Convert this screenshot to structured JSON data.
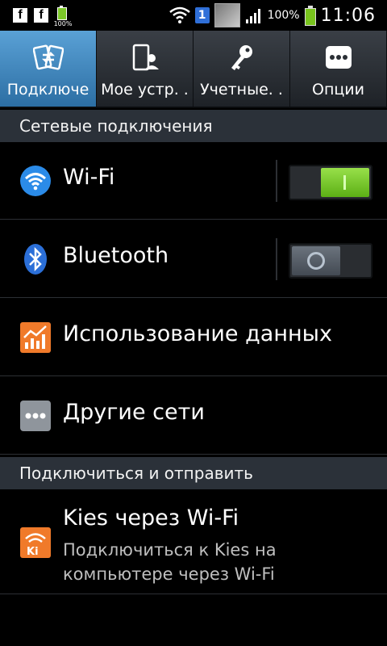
{
  "status_bar": {
    "small_battery_pct": "100%",
    "sim_badge": "1",
    "battery_pct": "100%",
    "time": "11:06",
    "icons": [
      "facebook-icon",
      "facebook-icon",
      "battery-icon",
      "wifi-icon",
      "sim-icon",
      "image-thumbnail",
      "signal-icon",
      "battery-icon"
    ]
  },
  "tabs": [
    {
      "label": "Подключе",
      "icon": "connections-icon",
      "active": true
    },
    {
      "label": "Мое устр. .",
      "icon": "device-icon",
      "active": false
    },
    {
      "label": "Учетные. .",
      "icon": "key-icon",
      "active": false
    },
    {
      "label": "Опции",
      "icon": "more-icon",
      "active": false
    }
  ],
  "sections": {
    "network": "Сетевые подключения",
    "share": "Подключиться и отправить"
  },
  "rows": {
    "wifi": {
      "label": "Wi-Fi",
      "toggle": "on"
    },
    "bluetooth": {
      "label": "Bluetooth",
      "toggle": "off"
    },
    "data_usage": {
      "label": "Использование данных"
    },
    "other_networks": {
      "label": "Другие сети"
    },
    "kies": {
      "title": "Kies через Wi-Fi",
      "subtitle": "Подключиться к Kies на компьютере через Wi-Fi"
    }
  },
  "colors": {
    "accent_tab": "#3f86c2",
    "switch_on": "#7cc829",
    "section_bg": "#2b3139"
  }
}
